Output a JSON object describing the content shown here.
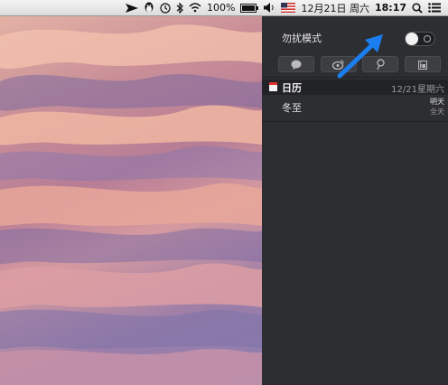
{
  "menubar": {
    "battery": "100%",
    "date": "12月21日 周六",
    "time": "18:17"
  },
  "notification_center": {
    "dnd_label": "勿扰模式",
    "dnd_enabled": false,
    "share_buttons": [
      "messages-share-icon",
      "weibo-share-icon",
      "tencent-weibo-share-icon",
      "linkedin-share-icon"
    ],
    "calendar": {
      "title": "日历",
      "date": "12/21星期六",
      "events": [
        {
          "title": "冬至",
          "when": "明天",
          "duration": "全天"
        }
      ]
    }
  },
  "colors": {
    "panel_bg": "#2d2e31",
    "annotation_arrow": "#1a7ef0"
  }
}
